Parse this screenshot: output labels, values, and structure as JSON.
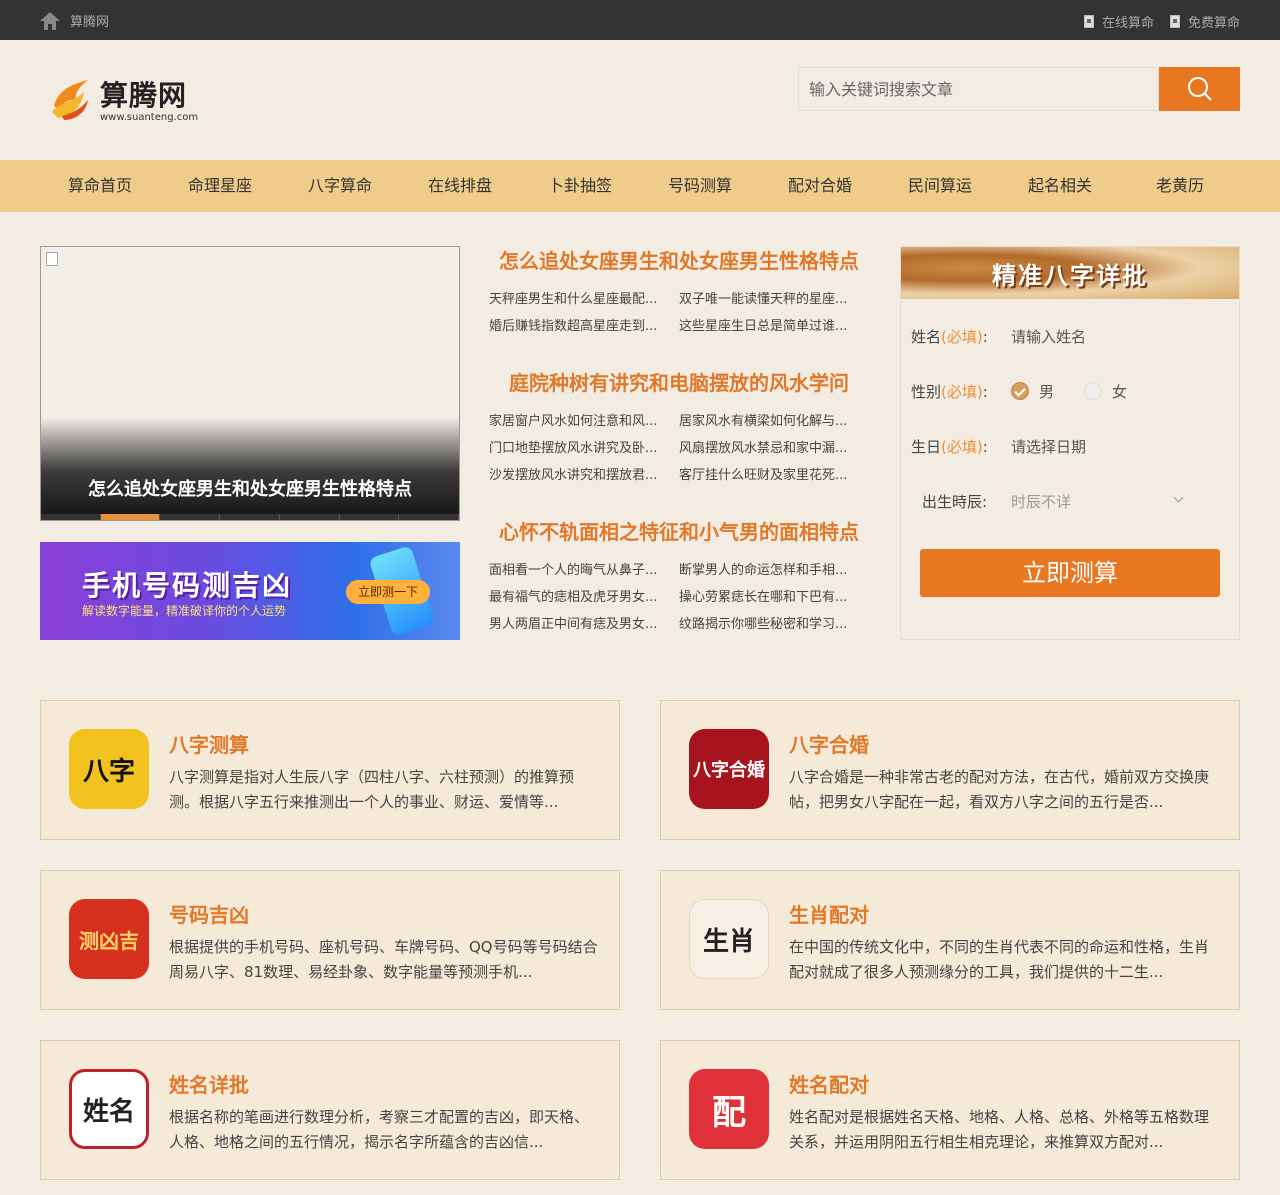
{
  "topbar": {
    "site": "算腾网",
    "links": [
      "在线算命",
      "免费算命"
    ]
  },
  "header": {
    "logo_text": "算腾网",
    "logo_sub": "www.suanteng.com",
    "search_placeholder": "输入关键词搜索文章"
  },
  "nav": [
    "算命首页",
    "命理星座",
    "八字算命",
    "在线排盘",
    "卜卦抽签",
    "号码测算",
    "配对合婚",
    "民间算运",
    "起名相关",
    "老黄历"
  ],
  "slider": {
    "caption": "怎么追处女座男生和处女座男生性格特点"
  },
  "banner": {
    "title": "手机号码测吉凶",
    "subtitle": "解读数字能量，精准破译你的个人运势",
    "cta": "立即测一下"
  },
  "news": [
    {
      "title": "怎么追处女座男生和处女座男生性格特点",
      "items": [
        "天秤座男生和什么星座最配...",
        "双子唯一能读懂天秤的星座...",
        "婚后赚钱指数超高星座走到...",
        "这些星座生日总是简单过谁..."
      ]
    },
    {
      "title": "庭院种树有讲究和电脑摆放的风水学问",
      "items": [
        "家居窗户风水如何注意和风...",
        "居家风水有横梁如何化解与...",
        "门口地垫摆放风水讲究及卧...",
        "风扇摆放风水禁忌和家中漏...",
        "沙发摆放风水讲究和摆放君...",
        "客厅挂什么旺财及家里花死..."
      ]
    },
    {
      "title": "心怀不轨面相之特征和小气男的面相特点",
      "items": [
        "面相看一个人的晦气从鼻子...",
        "断掌男人的命运怎样和手相...",
        "最有福气的痣相及虎牙男女...",
        "操心劳累痣长在哪和下巴有...",
        "男人两眉正中间有痣及男女...",
        "纹路揭示你哪些秘密和学习..."
      ]
    }
  ],
  "form": {
    "title": "精准八字详批",
    "name_label": "姓名",
    "required": "(必填)",
    "colon": ":",
    "name_placeholder": "请输入姓名",
    "gender_label": "性别",
    "male": "男",
    "female": "女",
    "birthday_label": "生日",
    "birthday_placeholder": "请选择日期",
    "hour_label": "出生時辰",
    "hour_value": "时辰不详",
    "submit": "立即测算"
  },
  "cards": [
    {
      "title": "八字测算",
      "icon_text": "八字",
      "desc": "八字测算是指对人生辰八字（四柱八字、六柱预测）的推算预测。根据八字五行来推测出一个人的事业、财运、爱情等..."
    },
    {
      "title": "八字合婚",
      "icon_text": "八字合婚",
      "desc": "八字合婚是一种非常古老的配对方法，在古代，婚前双方交换庚帖，把男女八字配在一起，看双方八字之间的五行是否..."
    },
    {
      "title": "号码吉凶",
      "icon_text": "测凶吉",
      "desc": "根据提供的手机号码、座机号码、车牌号码、QQ号码等号码结合周易八字、81数理、易经卦象、数字能量等预测手机..."
    },
    {
      "title": "生肖配对",
      "icon_text": "生肖",
      "desc": "在中国的传统文化中，不同的生肖代表不同的命运和性格，生肖配对就成了很多人预测缘分的工具，我们提供的十二生..."
    },
    {
      "title": "姓名详批",
      "icon_text": "姓名",
      "desc": "根据名称的笔画进行数理分析，考察三才配置的吉凶，即天格、人格、地格之间的五行情况，揭示名字所蕴含的吉凶信..."
    },
    {
      "title": "姓名配对",
      "icon_text": "配",
      "desc": "姓名配对是根据姓名天格、地格、人格、总格、外格等五格数理关系，并运用阴阳五行相生相克理论，来推算双方配对..."
    }
  ],
  "colors": {
    "accent": "#e87722",
    "nav_bg": "#f0cc8a",
    "topbar_bg": "#333333",
    "page_bg": "#f3ece2"
  }
}
